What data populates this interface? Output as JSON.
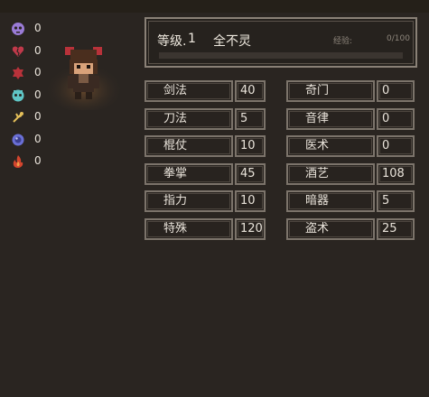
{
  "status_counts": [
    {
      "icon": "purple-skull-icon",
      "color": "#9a7bd6",
      "count": "0"
    },
    {
      "icon": "broken-heart-icon",
      "color": "#c0394a",
      "count": "0"
    },
    {
      "icon": "red-blob-icon",
      "color": "#b8323a",
      "count": "0"
    },
    {
      "icon": "teal-skull-icon",
      "color": "#5fc6c6",
      "count": "0"
    },
    {
      "icon": "yellow-spark-icon",
      "color": "#e5c05a",
      "count": "0"
    },
    {
      "icon": "blue-orb-icon",
      "color": "#6a6fd6",
      "count": "0"
    },
    {
      "icon": "red-flame-icon",
      "color": "#d4452e",
      "count": "0"
    }
  ],
  "character": {
    "level_label": "等级.",
    "level": "1",
    "name": "全不灵",
    "exp_label": "经验:",
    "exp_value": "0/100",
    "exp_fraction": 0
  },
  "stats_left": [
    {
      "label": "剑法",
      "value": "40"
    },
    {
      "label": "刀法",
      "value": "5"
    },
    {
      "label": "棍仗",
      "value": "10"
    },
    {
      "label": "拳掌",
      "value": "45"
    },
    {
      "label": "指力",
      "value": "10"
    },
    {
      "label": "特殊",
      "value": "120"
    }
  ],
  "stats_right": [
    {
      "label": "奇门",
      "value": "0"
    },
    {
      "label": "音律",
      "value": "0"
    },
    {
      "label": "医术",
      "value": "0"
    },
    {
      "label": "酒艺",
      "value": "108"
    },
    {
      "label": "暗器",
      "value": "5"
    },
    {
      "label": "盗术",
      "value": "25"
    }
  ],
  "colors": {
    "background": "#2a2521",
    "frame": "#8a8177",
    "text": "#e9e3da",
    "exp_fill": "#b59a62"
  }
}
